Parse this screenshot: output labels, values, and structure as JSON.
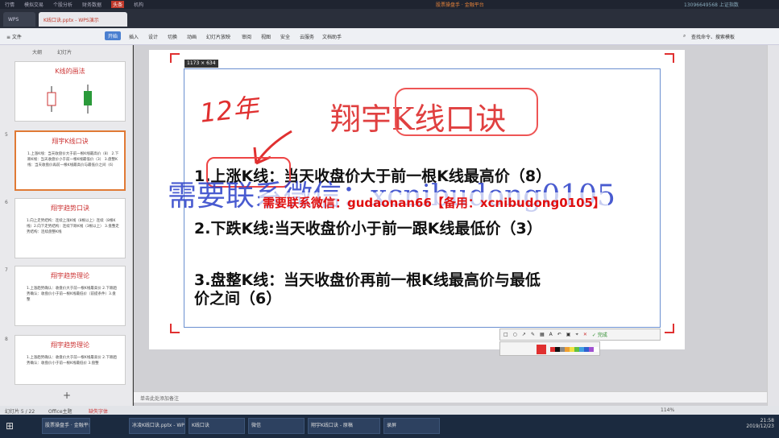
{
  "menubar": {
    "items": [
      "行情",
      "模拟交易",
      "个股分析",
      "财务数据",
      "机构"
    ],
    "active": "头条",
    "center": "股票操盘手 · 金融平台",
    "right": "13096649568  上证指数"
  },
  "tabs": {
    "app": "WPS",
    "document": "K线口诀.pptx - WPS演示"
  },
  "ribbon": {
    "file": "≡ 文件",
    "items": [
      "开始",
      "插入",
      "设计",
      "切换",
      "动画",
      "幻灯片放映",
      "审阅",
      "视图",
      "安全",
      "云服务",
      "文档助手"
    ],
    "search": "查找命令、搜索模板"
  },
  "sidebar": {
    "tab_outline": "大纲",
    "tab_slides": "幻灯片",
    "slides": [
      {
        "num": "",
        "title": "K线的画法",
        "text": ""
      },
      {
        "num": "5",
        "title": "翔宇K线口诀",
        "text": "1.上涨K线：当天收盘价大于前一根K线最高价（8） 2.下跌K线：当天收盘价小于前一根K线最低价（3） 3.盘整K线：当天收盘价再前一根K线最高价与最低价之间（6）"
      },
      {
        "num": "6",
        "title": "翔宇趋势口诀",
        "text": "1.向上走势结构：连续上涨K线（8根以上）连续（8根K线）2.向下走势结构：连续下跌K线（3根以上） 3.盘整走势结构：连续盘整K线"
      },
      {
        "num": "7",
        "title": "翔宇趋势理论",
        "text": "1.上涨趋势确认：收盘价大于前一根K线最高价 2.下跌趋势确认：收盘价小于前一根K线最低价（前提条件）3.盘整"
      },
      {
        "num": "8",
        "title": "翔宇趋势理论",
        "text": "1.上涨趋势确认：收盘价大于前一根K线最高价 2.下跌趋势确认：收盘价小于前一根K线最低价 3.盘整"
      }
    ],
    "add": "+"
  },
  "slide": {
    "dimension_badge": "1173 × 634",
    "handwritten_year": "12年",
    "title": "翔宇K线口诀",
    "line1": "1.上涨K线：当天收盘价大于前一根K线最高价（8）",
    "line2": "2.下跌K线:当天收盘价小于前一跟K线最低价（3）",
    "line3a": "3.盘整K线：当天收盘价再前一根K线最高价与最低",
    "line3b": "价之间（6）",
    "watermark_blue": "需要联系微信：xcnibudong0105",
    "watermark_red": "需要联系微信：gudaonan66【备用：xcnibudong0105】"
  },
  "snip_toolbar": {
    "done": "✓ 完成",
    "cancel": "✕",
    "colors": [
      "#e03030",
      "#111111",
      "#888888",
      "#f0a030",
      "#f0e040",
      "#60c040",
      "#40a0e0",
      "#3060d0",
      "#a050d0",
      "#ffffff"
    ]
  },
  "notes_placeholder": "单击此处添加备注",
  "status": {
    "left": "幻灯片 5 / 22",
    "theme": "Office主题",
    "zoom": "114%",
    "right": "缺失字体"
  },
  "taskbar": {
    "start": "⊞",
    "items": [
      "股票操盘手 · 金融平台",
      "冰凌K线口诀.pptx - WPS",
      "K线口诀",
      "微信",
      "翔宇K线口诀 - 原稿",
      "录屏"
    ],
    "time": "21:58",
    "date": "2019/12/23"
  }
}
